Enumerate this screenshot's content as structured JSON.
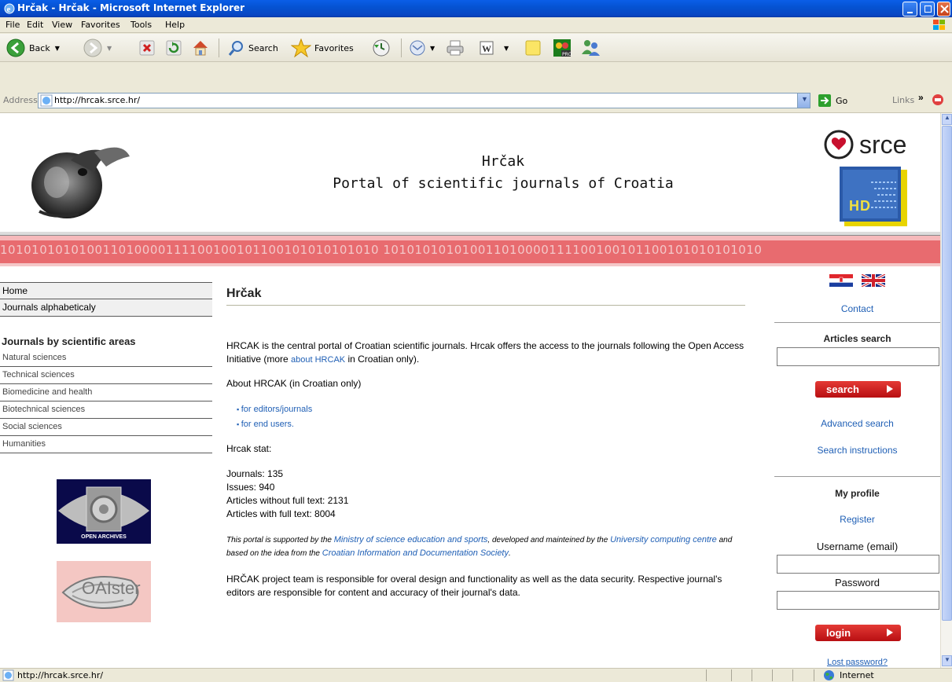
{
  "window": {
    "title": "Hrčak - Hrčak - Microsoft Internet Explorer"
  },
  "menubar": {
    "items": [
      "File",
      "Edit",
      "View",
      "Favorites",
      "Tools",
      "Help"
    ]
  },
  "toolbar": {
    "back_label": "Back",
    "search_label": "Search",
    "favorites_label": "Favorites"
  },
  "addressbar": {
    "label": "Address",
    "url": "http://hrcak.srce.hr/",
    "go_label": "Go",
    "links_label": "Links"
  },
  "header": {
    "site_name": "Hrčak",
    "site_subtitle": "Portal of scientific journals of Croatia",
    "srce_logo_text": "srce",
    "binary_text": "101010101010011010000111100100101100101010101010 101010101010011010000111100100101100101010101010"
  },
  "leftnav": {
    "links": [
      "Home",
      "Journals alphabeticaly"
    ],
    "areas_heading": "Journals by scientific areas",
    "areas": [
      "Natural sciences",
      "Technical sciences",
      "Biomedicine and health",
      "Biotechnical sciences",
      "Social sciences",
      "Humanities"
    ],
    "open_archives_logo": "OPEN ARCHIVES",
    "oaister_logo": "OAIster"
  },
  "main": {
    "heading": "Hrčak",
    "intro_before": "HRCAK is the central portal of Croatian scientific journals. Hrcak offers the access to the journals following the Open Access Initiative (more ",
    "intro_link": "about HRCAK",
    "intro_after": " in Croatian only).",
    "about_heading": "About HRCAK (in Croatian only)",
    "about_links": [
      "for editors/journals",
      "for end users."
    ],
    "stat_heading": "Hrcak stat:",
    "stats": [
      "Journals: 135",
      "Issues: 940",
      "Articles without full text: 2131",
      "Articles with full text: 8004"
    ],
    "support_1": "This portal is supported by the ",
    "support_link_1": "Ministry of science education and sports",
    "support_2": ", developed and mainteined by the ",
    "support_link_2": "University computing centre",
    "support_3": " and based on the idea from the ",
    "support_link_3": "Croatian Information and Documentation Society",
    "support_4": ".",
    "team_text": "HRČAK project team is responsible for overal design and functionality as well as the data security. Respective journal's editors are responsible for content and accuracy of their journal's data."
  },
  "rightpanel": {
    "contact": "Contact",
    "articles_search_heading": "Articles search",
    "search_value": "",
    "search_button": "search",
    "advanced_search": "Advanced search",
    "search_instructions": "Search instructions",
    "my_profile_heading": "My profile",
    "register": "Register",
    "username_label": "Username (email)",
    "username_value": "",
    "password_label": "Password",
    "password_value": "",
    "login_button": "login",
    "lost_password": "Lost password?"
  },
  "statusbar": {
    "url": "http://hrcak.srce.hr/",
    "zone": "Internet"
  },
  "colors": {
    "link": "#1f5fb5",
    "accent_red": "#c41a1a",
    "band_red": "#e86b6f",
    "titlebar_blue": "#0553d2"
  }
}
